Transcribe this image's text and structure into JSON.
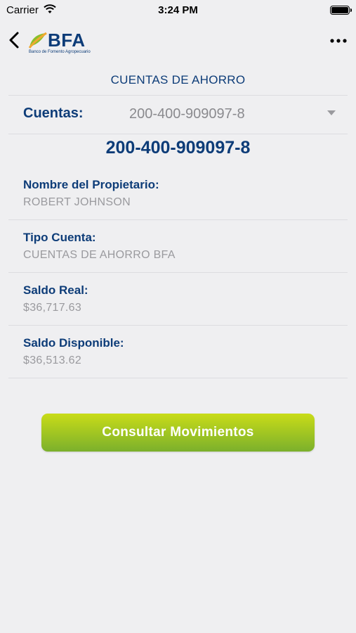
{
  "status": {
    "carrier": "Carrier",
    "time": "3:24 PM"
  },
  "brand": {
    "name": "BFA",
    "subtitle": "Banco de Fomento Agropecuario",
    "accent": "#0d3c78",
    "button_gradient": [
      "#c9dc18",
      "#7bb02c"
    ]
  },
  "header": {
    "title": "CUENTAS DE AHORRO"
  },
  "selector": {
    "label": "Cuentas:",
    "value": "200-400-909097-8"
  },
  "account_number": "200-400-909097-8",
  "fields": [
    {
      "label": "Nombre del Propietario:",
      "value": "ROBERT JOHNSON"
    },
    {
      "label": "Tipo Cuenta:",
      "value": "CUENTAS DE AHORRO BFA"
    },
    {
      "label": "Saldo Real:",
      "value": "$36,717.63"
    },
    {
      "label": "Saldo Disponible:",
      "value": "$36,513.62"
    }
  ],
  "actions": {
    "consult": "Consultar Movimientos"
  },
  "icons": {
    "back": "chevron-left-icon",
    "more": "more-horizontal-icon",
    "wifi": "wifi-icon",
    "battery": "battery-icon",
    "dropdown": "caret-down-icon"
  }
}
